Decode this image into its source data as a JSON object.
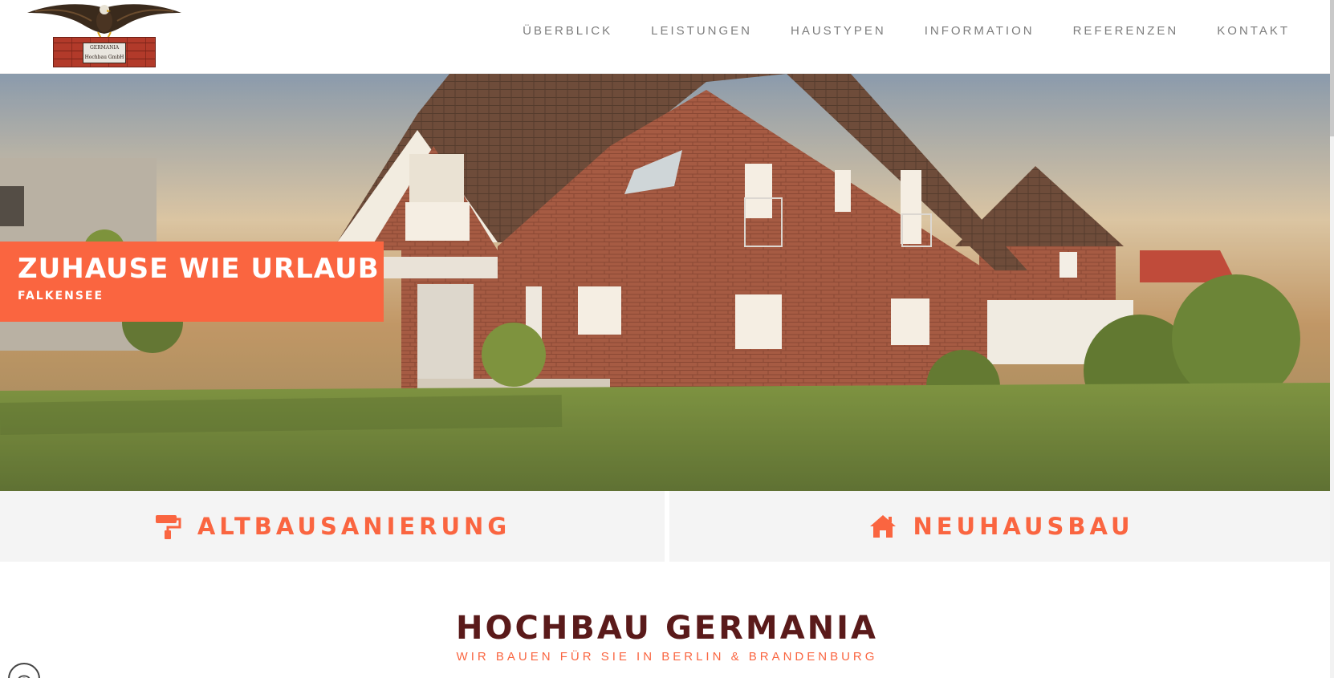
{
  "brand": {
    "logo_plate_line1": "GERMANIA",
    "logo_plate_line2": "Hochbau GmbH",
    "accent_color": "#fa6540",
    "headline_color": "#5a1a1a"
  },
  "nav": {
    "items": [
      {
        "label": "ÜBERBLICK"
      },
      {
        "label": "LEISTUNGEN"
      },
      {
        "label": "HAUSTYPEN"
      },
      {
        "label": "INFORMATION"
      },
      {
        "label": "REFERENZEN"
      },
      {
        "label": "KONTAKT"
      }
    ]
  },
  "hero": {
    "title": "ZUHAUSE WIE URLAUB",
    "subtitle": "FALKENSEE"
  },
  "tiles": [
    {
      "label": "ALTBAUSANIERUNG",
      "icon": "paint-roller-icon"
    },
    {
      "label": "NEUHAUSBAU",
      "icon": "home-icon"
    }
  ],
  "headline": {
    "title": "HOCHBAU GERMANIA",
    "subtitle": "WIR BAUEN FÜR SIE IN BERLIN & BRANDENBURG"
  }
}
